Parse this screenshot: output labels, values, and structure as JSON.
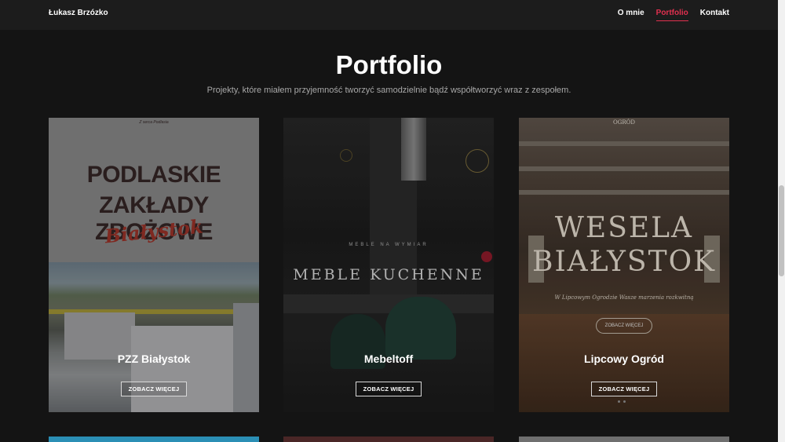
{
  "header": {
    "brand": "Łukasz Brzózko",
    "nav": [
      {
        "label": "O mnie",
        "active": false
      },
      {
        "label": "Portfolio",
        "active": true
      },
      {
        "label": "Kontakt",
        "active": false
      }
    ],
    "accent_color": "#e0304f"
  },
  "hero": {
    "title": "Portfolio",
    "subtitle": "Projekty, które miałem przyjemność tworzyć samodzielnie bądź współtworzyć wraz z zespołem."
  },
  "projects": [
    {
      "title": "PZZ Białystok",
      "button": "ZOBACZ WIĘCEJ",
      "image_text": {
        "tiny": "Z serca Podlasia",
        "line1": "PODLASKIE",
        "line2": "ZAKŁADY ZBOŻOWE",
        "line3": "Białystok"
      }
    },
    {
      "title": "Mebeltoff",
      "button": "ZOBACZ WIĘCEJ",
      "image_text": {
        "small": "MEBLE NA WYMIAR",
        "big": "MEBLE KUCHENNE"
      }
    },
    {
      "title": "Lipcowy Ogród",
      "button": "ZOBACZ WIĘCEJ",
      "image_text": {
        "logo": "OGRÓD",
        "line1": "WESELA",
        "line2": "BIAŁYSTOK",
        "tagline": "W Lipcowym Ogrodzie Wasze marzenia rozkwitną",
        "pill": "ZOBACZ WIĘCEJ"
      }
    }
  ]
}
